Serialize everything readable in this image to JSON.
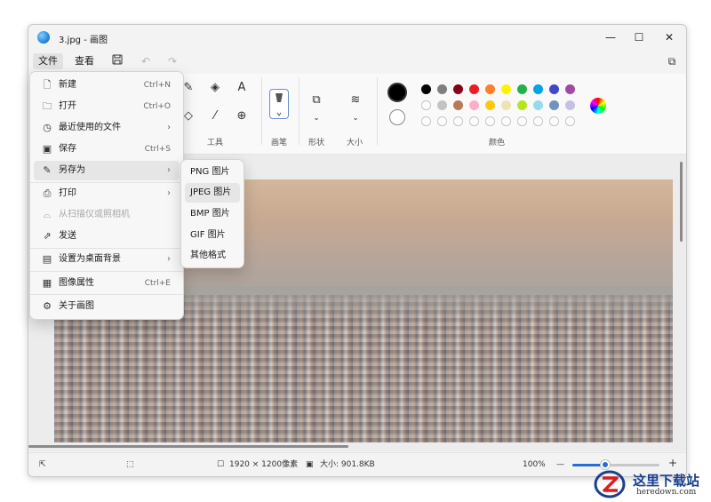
{
  "window": {
    "title": "3.jpg - 画图",
    "minimize": "—",
    "maximize": "☐",
    "close": "✕"
  },
  "menubar": {
    "file": "文件",
    "view": "查看"
  },
  "ribbon": {
    "tools_label": "工具",
    "brush_label": "画笔",
    "shapes_label": "形状",
    "size_label": "大小",
    "colors_label": "颜色",
    "text_tool": "A",
    "swatch_colors_row1": [
      "#000000",
      "#7f7f7f",
      "#880015",
      "#ed1c24",
      "#ff7f27",
      "#fff200",
      "#22b14c",
      "#00a2e8",
      "#3f48cc",
      "#a349a4"
    ],
    "swatch_colors_row2": [
      "#ffffff",
      "#c3c3c3",
      "#b97a57",
      "#ffaec9",
      "#ffc90e",
      "#efe4b0",
      "#b5e61d",
      "#99d9ea",
      "#7092be",
      "#c8bfe7"
    ]
  },
  "file_menu": {
    "items": [
      {
        "label": "新建",
        "shortcut": "Ctrl+N",
        "icon": "new-file-icon"
      },
      {
        "label": "打开",
        "shortcut": "Ctrl+O",
        "icon": "open-folder-icon"
      },
      {
        "label": "最近使用的文件",
        "arrow": "›",
        "icon": "recent-clock-icon"
      },
      {
        "label": "保存",
        "shortcut": "Ctrl+S",
        "icon": "save-icon"
      },
      {
        "label": "另存为",
        "arrow": "›",
        "icon": "save-as-icon"
      },
      {
        "label": "打印",
        "arrow": "›",
        "icon": "print-icon"
      },
      {
        "label": "从扫描仪或照相机",
        "icon": "scanner-icon",
        "disabled": true
      },
      {
        "label": "发送",
        "icon": "share-icon"
      },
      {
        "label": "设置为桌面背景",
        "arrow": "›",
        "icon": "desktop-background-icon"
      },
      {
        "label": "图像属性",
        "shortcut": "Ctrl+E",
        "icon": "image-properties-icon"
      },
      {
        "label": "关于画图",
        "icon": "settings-gear-icon"
      }
    ]
  },
  "save_as_submenu": {
    "items": [
      "PNG 图片",
      "JPEG 图片",
      "BMP 图片",
      "GIF 图片",
      "其他格式"
    ]
  },
  "statusbar": {
    "dimensions": "1920 × 1200像素",
    "size": "大小: 901.8KB",
    "zoom": "100%",
    "zoom_minus": "—",
    "zoom_plus": "+",
    "zoom_level": 0.38
  },
  "watermark": {
    "name": "这里下载站",
    "url": "heredown.com"
  }
}
